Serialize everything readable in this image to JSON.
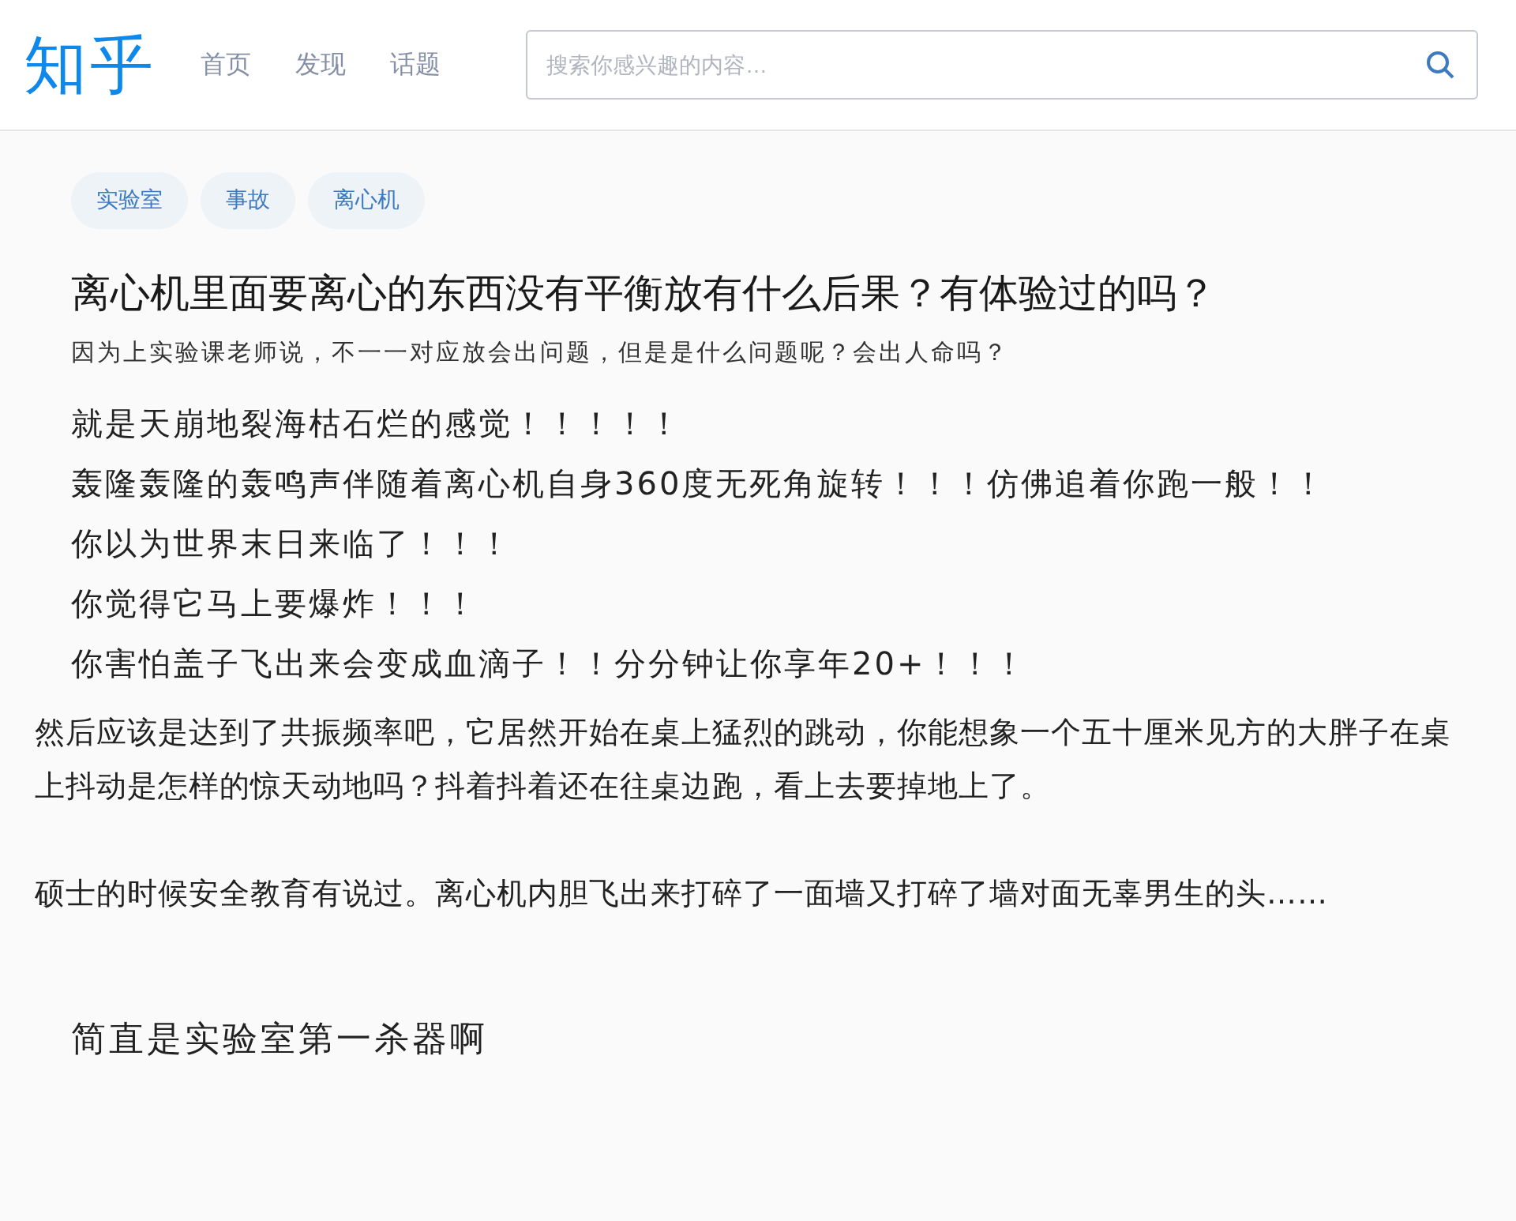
{
  "header": {
    "logo": "知乎",
    "nav": [
      {
        "label": "首页",
        "selected": false
      },
      {
        "label": "发现",
        "selected": false
      },
      {
        "label": "话题",
        "selected": false
      }
    ],
    "search": {
      "placeholder": "搜索你感兴趣的内容…"
    }
  },
  "question": {
    "tags": [
      "实验室",
      "事故",
      "离心机"
    ],
    "title": "离心机里面要离心的东西没有平衡放有什么后果？有体验过的吗？",
    "detail": "因为上实验课老师说，不一一对应放会出问题，但是是什么问题呢？会出人命吗？"
  },
  "answer": {
    "lines": [
      "就是天崩地裂海枯石烂的感觉！！！！！",
      "轰隆轰隆的轰鸣声伴随着离心机自身360度无死角旋转！！！仿佛追着你跑一般！！",
      "你以为世界末日来临了！！！",
      "你觉得它马上要爆炸！！！",
      "你害怕盖子飞出来会变成血滴子！！分分钟让你享年20+！！！"
    ],
    "paragraphs": [
      "然后应该是达到了共振频率吧，它居然开始在桌上猛烈的跳动，你能想象一个五十厘米见方的大胖子在桌上抖动是怎样的惊天动地吗？抖着抖着还在往桌边跑，看上去要掉地上了。",
      "硕士的时候安全教育有说过。离心机内胆飞出来打碎了一面墙又打碎了墙对面无辜男生的头……"
    ],
    "closing": "简直是实验室第一杀器啊"
  }
}
